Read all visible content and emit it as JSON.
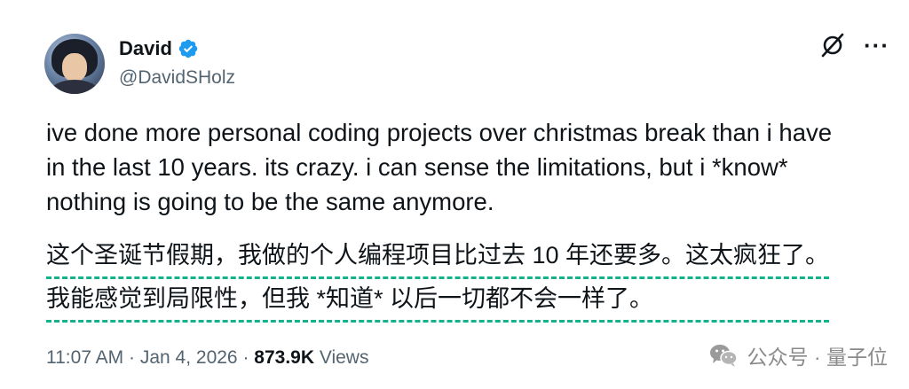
{
  "author": {
    "display_name": "David",
    "handle": "@DavidSHolz",
    "verified": true
  },
  "tweet": {
    "lines": [
      "ive done more personal coding projects over christmas break than i have",
      "in the last 10 years. its crazy. i can sense the limitations, but i *know*",
      "nothing is going to be the same anymore."
    ],
    "translation_lines": [
      "这个圣诞节假期，我做的个人编程项目比过去 10 年还要多。这太疯狂了。",
      "我能感觉到局限性，但我 *知道* 以后一切都不会一样了。"
    ]
  },
  "meta": {
    "time": "11:07 AM",
    "separator": " · ",
    "date": "Jan 4, 2026",
    "views_count": "873.9K",
    "views_label": " Views"
  },
  "watermark": {
    "text": "公众号 · 量子位"
  },
  "icons": {
    "verified": "verified-badge-icon",
    "grok": "grok-icon",
    "more": "more-options-icon",
    "wechat": "wechat-icon"
  },
  "colors": {
    "verified_blue": "#1d9bf0",
    "underline_green": "#12b28a",
    "secondary_text": "#536471"
  }
}
